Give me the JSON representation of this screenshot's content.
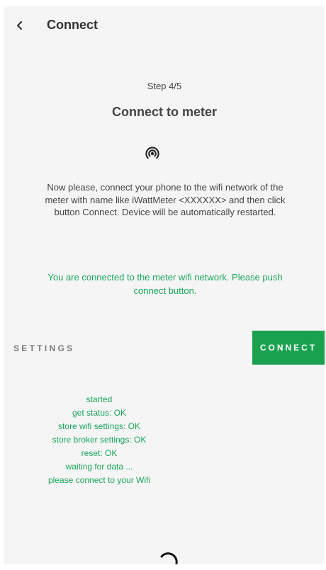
{
  "appbar": {
    "back_icon": "chevron-left-icon",
    "title": "Connect"
  },
  "content": {
    "step": "Step 4/5",
    "heading": "Connect to meter",
    "wifi_icon": "wifi-tethering-icon",
    "instructions": "Now please, connect your phone to the wifi network of the meter with name like iWattMeter <XXXXXX> and then click button Connect. Device will be automatically restarted.",
    "connected_message": "You are connected to the meter wifi network. Please push connect button."
  },
  "actions": {
    "settings_label": "SETTINGS",
    "connect_label": "CONNECT"
  },
  "log": [
    "started",
    "get status: OK",
    "store wifi settings: OK",
    "store broker settings: OK",
    "reset: OK",
    "waiting for data ...",
    "please connect to your Wifi"
  ],
  "colors": {
    "accent": "#1aa14f",
    "status_text": "#1aa55a",
    "background": "#f5f5f5"
  }
}
